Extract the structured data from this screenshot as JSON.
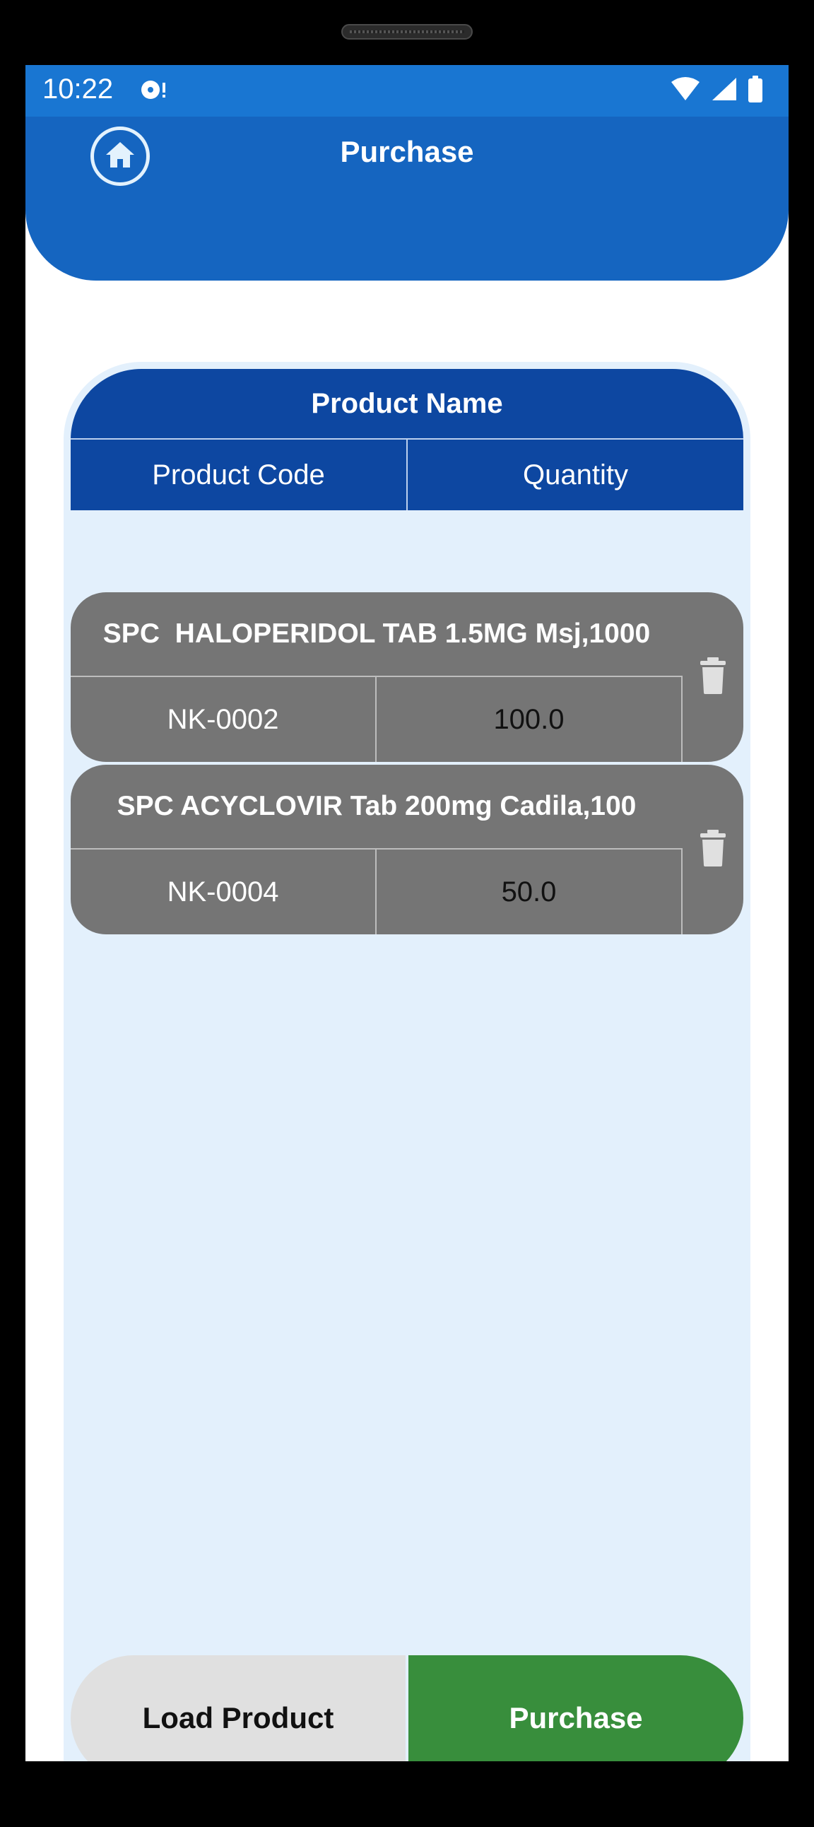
{
  "status_bar": {
    "time": "10:22",
    "icons": [
      "disc-alert-icon",
      "wifi-icon",
      "cell-signal-icon",
      "battery-icon"
    ]
  },
  "header": {
    "title": "Purchase",
    "home_icon": "home-icon"
  },
  "table": {
    "header_name": "Product Name",
    "header_code": "Product Code",
    "header_quantity": "Quantity"
  },
  "items": [
    {
      "name": "SPC  HALOPERIDOL TAB 1.5MG Msj,1000",
      "code": "NK-0002",
      "quantity": "100.0",
      "delete_icon": "trash-icon"
    },
    {
      "name": "SPC ACYCLOVIR Tab 200mg Cadila,100",
      "code": "NK-0004",
      "quantity": "50.0",
      "delete_icon": "trash-icon"
    }
  ],
  "actions": {
    "load_label": "Load Product",
    "purchase_label": "Purchase"
  },
  "colors": {
    "status_bar": "#1976d2",
    "header": "#1565c0",
    "table_header": "#0d47a1",
    "panel": "#e3f0fc",
    "item": "#757575",
    "load_button": "#e0e0e0",
    "purchase_button": "#388e3c"
  }
}
